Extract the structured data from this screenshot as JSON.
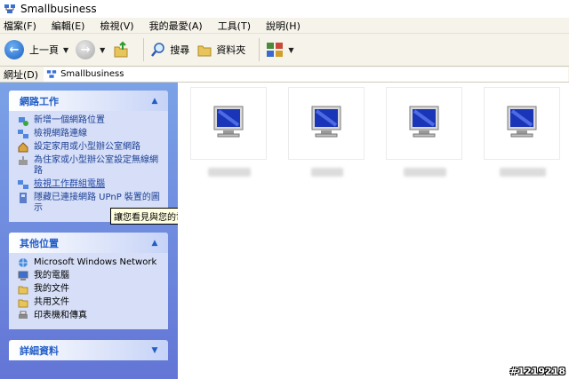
{
  "window": {
    "title": "Smallbusiness"
  },
  "menu": [
    "檔案(F)",
    "編輯(E)",
    "檢視(V)",
    "我的最愛(A)",
    "工具(T)",
    "說明(H)"
  ],
  "toolbar": {
    "back_label": "上一頁",
    "search_label": "搜尋",
    "folders_label": "資料夾"
  },
  "address": {
    "label": "網址(D)",
    "value": "Smallbusiness"
  },
  "network_tasks": {
    "title": "網路工作",
    "items": [
      "新增一個網路位置",
      "檢視網路連線",
      "設定家用或小型辦公室網路",
      "為住家或小型辦公室設定無線網路",
      "檢視工作群組電腦",
      "隱藏已連接網路 UPnP 裝置的圖示"
    ]
  },
  "tooltip": "讓您看見與您的電腦相同工作群組的所有電腦。",
  "other_places": {
    "title": "其他位置",
    "items": [
      "Microsoft Windows Network",
      "我的電腦",
      "我的文件",
      "共用文件",
      "印表機和傳真"
    ]
  },
  "details": {
    "title": "詳細資料"
  },
  "computers": [
    "",
    "",
    "",
    ""
  ],
  "watermark": "#1219218"
}
